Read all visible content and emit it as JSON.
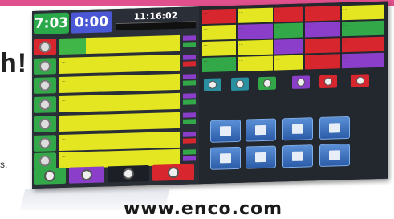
{
  "page": {
    "headline_fragment": "h!",
    "body_fragment": "s.",
    "url": "www.enco.com"
  },
  "screen": {
    "clock_elapsed": "7:03",
    "clock_remaining": "0:00",
    "time_of_day": "11:16:02",
    "playlist": [
      {
        "title": "..."
      },
      {
        "title": "..."
      },
      {
        "title": "..."
      },
      {
        "title": "..."
      },
      {
        "title": "..."
      },
      {
        "title": "..."
      },
      {
        "title": "..."
      }
    ],
    "colors": {
      "yellow": "#e3e620",
      "green": "#33a848",
      "purple": "#8a3ec9",
      "red": "#d8262e",
      "blue_tile": "#3a74c4"
    },
    "bottom_buttons": [
      "play-button",
      "record-button",
      "cue-button",
      "stop-button"
    ],
    "cart_walls": [
      "...",
      "...",
      "...",
      "...",
      "...",
      "...",
      "...",
      "...",
      "...",
      "...",
      "...",
      "...",
      "...",
      "...",
      "...",
      "...",
      "...",
      "...",
      "...",
      "...",
      "...",
      "...",
      "...",
      "...",
      "...",
      "...",
      "...",
      "...",
      "..."
    ],
    "cart_controls": [
      "play",
      "play",
      "play",
      "pause",
      "stop",
      "eject"
    ],
    "tiles": [
      "profile-icon",
      "document-icon",
      "folder-icon",
      "display-icon",
      "sky-icon",
      "bowl-icon",
      "station-icon",
      "window-icon"
    ]
  }
}
